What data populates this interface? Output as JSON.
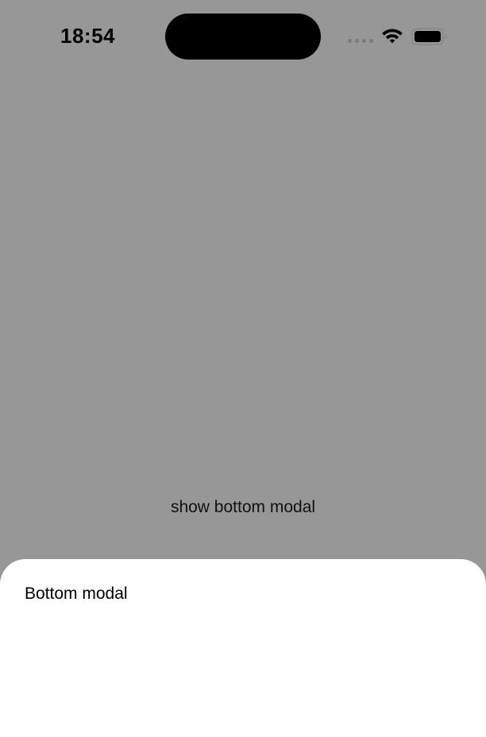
{
  "status_bar": {
    "time": "18:54",
    "icons": [
      "cellular-signal-icon",
      "wifi-icon",
      "battery-icon"
    ]
  },
  "main": {
    "button_label": "show bottom modal"
  },
  "modal": {
    "title": "Bottom modal"
  },
  "colors": {
    "overlay_background": "#979797",
    "modal_background": "#ffffff",
    "text": "#000000"
  }
}
